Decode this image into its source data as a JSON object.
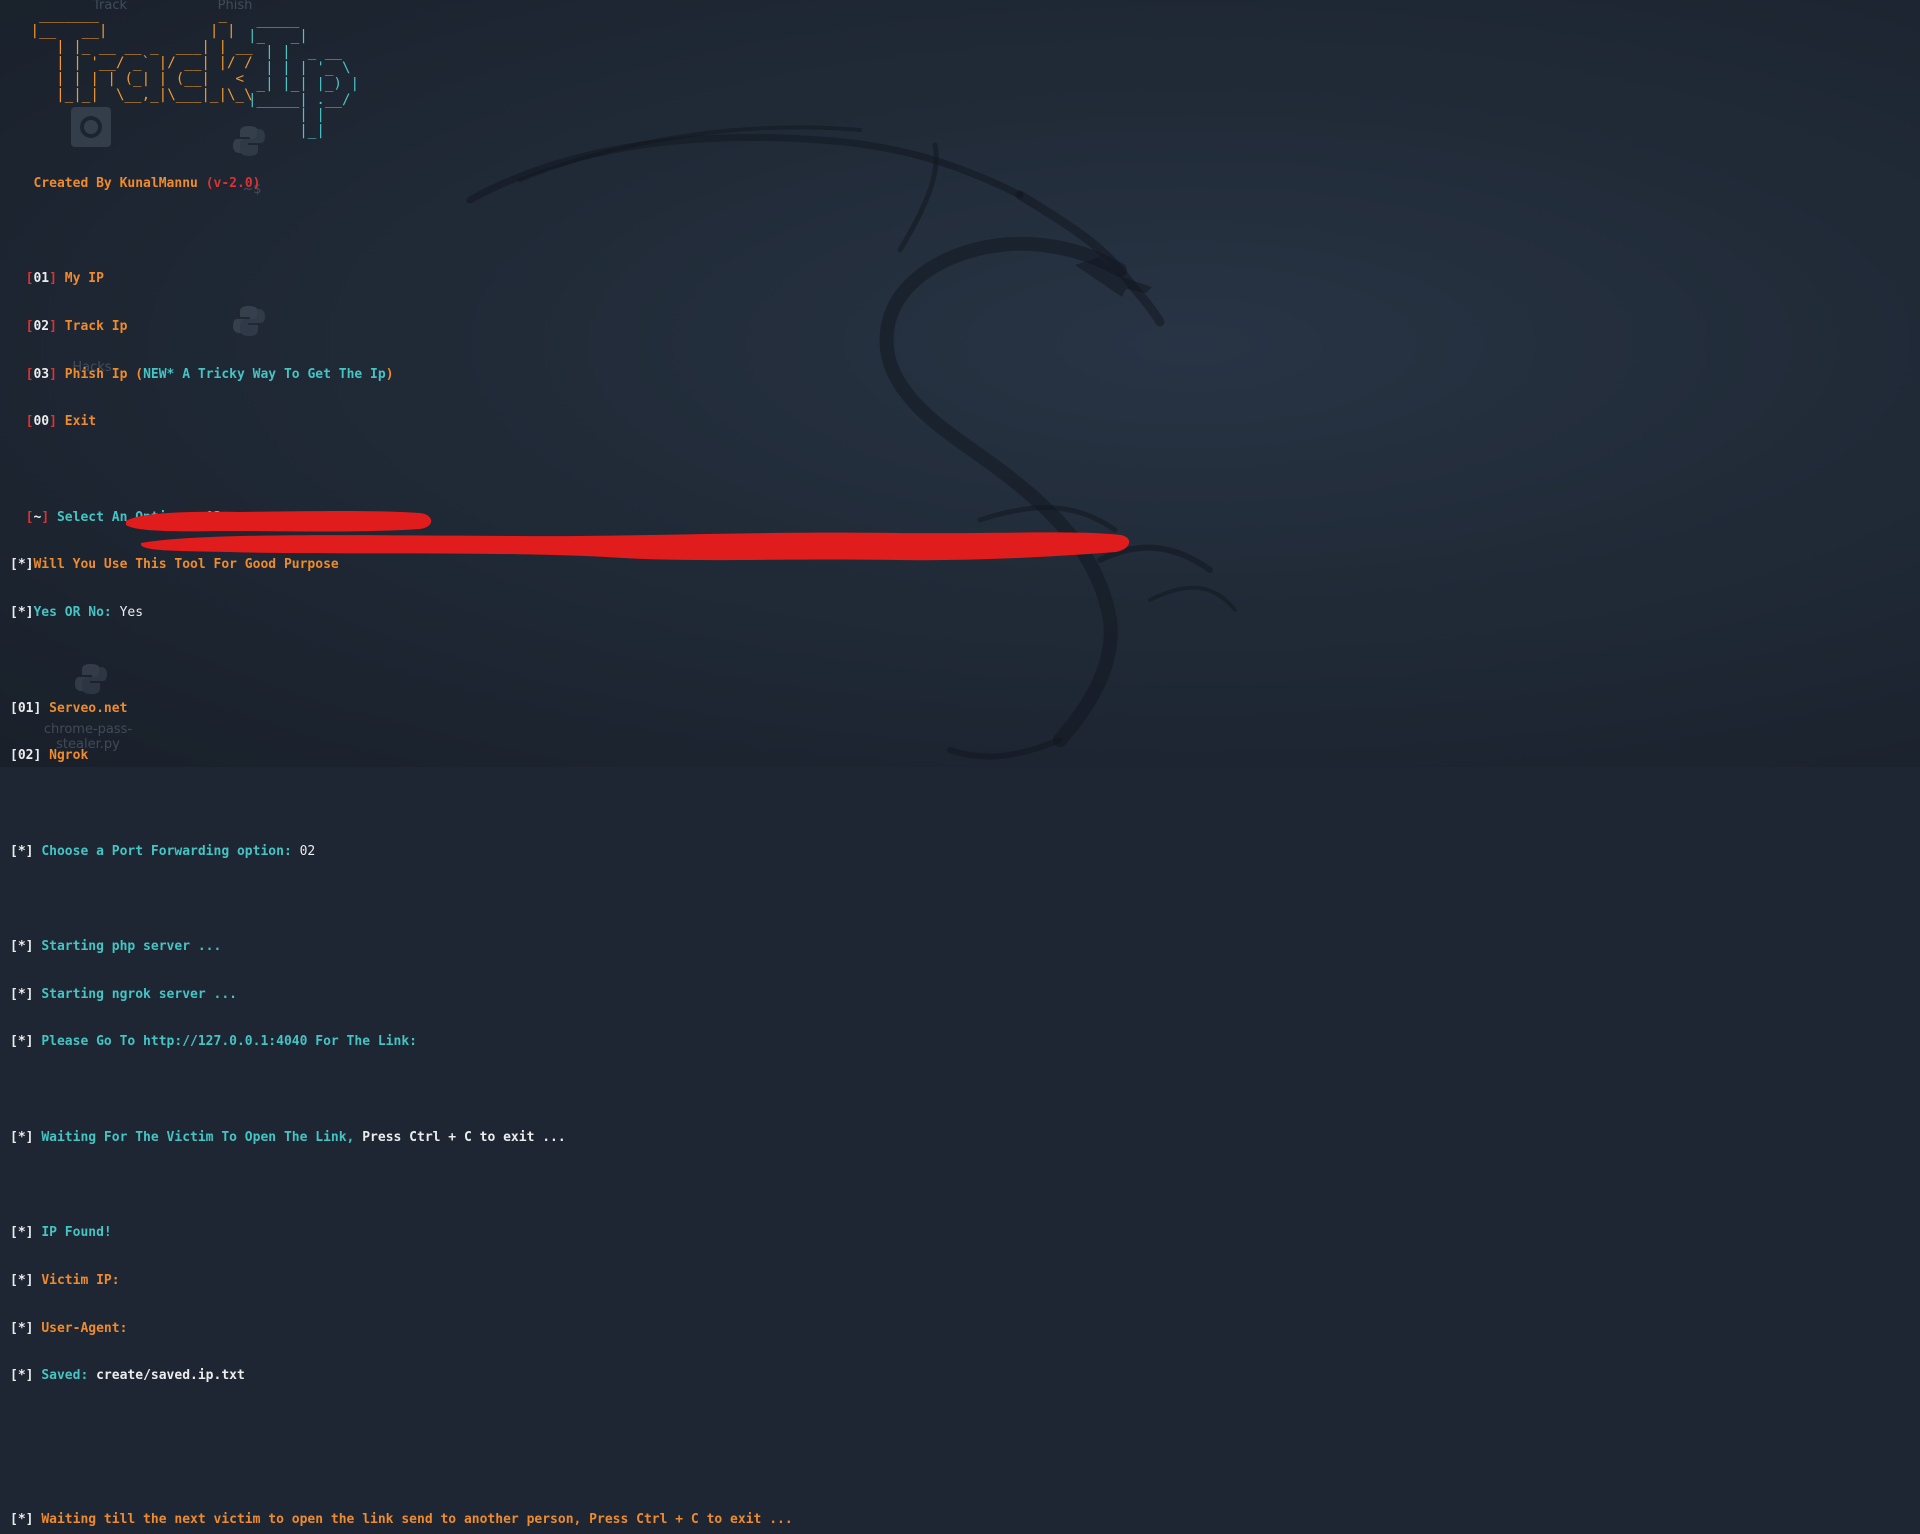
{
  "desktop": {
    "icons": [
      {
        "name": "top-file-1",
        "label": "Track"
      },
      {
        "name": "top-file-2",
        "label": "Phish"
      },
      {
        "name": "camera-file",
        "label": ""
      },
      {
        "name": "python-file-1",
        "label": "~$"
      },
      {
        "name": "python-file-2",
        "label": "Hacks"
      },
      {
        "name": "python-file-3",
        "label": ""
      },
      {
        "name": "python-file-bottom",
        "label": "chrome-pass-stealer.py"
      }
    ]
  },
  "banner": {
    "ascii_track": "  _______              _\n |__   __|            | |\n    | |_ __ __ _  ___| | __\n    | | '__/ _` |/ __| |/ /\n    | | | | (_| | (__|   <\n    |_|_|  \\__,_|\\___|_|\\_\\",
    "ascii_ip": " _____\n|_   _|\n  | |  _ __\n  | | | '_ \\\n _| |_| |_) |\n|_____| .__/\n      | |\n      |_|",
    "credit_text": "Created By KunalMannu",
    "version": "(v-2.0)"
  },
  "menu": [
    {
      "num": "01",
      "label": "My IP"
    },
    {
      "num": "02",
      "label": "Track Ip"
    },
    {
      "num": "03",
      "label": "Phish Ip",
      "note": "NEW* A Tricky Way To Get The Ip"
    },
    {
      "num": "00",
      "label": "Exit"
    }
  ],
  "prompts": {
    "select_mark": "~",
    "select_label": "Select An Option :",
    "select_value": "03",
    "purpose_question": "Will You Use This Tool For Good Purpose",
    "yes_no_label": "Yes OR No:",
    "yes_no_value": "Yes"
  },
  "forwarding": [
    {
      "num": "01",
      "label": "Serveo.net"
    },
    {
      "num": "02",
      "label": "Ngrok"
    }
  ],
  "choose": {
    "label": "Choose a Port Forwarding option:",
    "value": "02"
  },
  "status": {
    "star": "*",
    "php": "Starting php server ...",
    "ngrok": "Starting ngrok server ...",
    "link": "Please Go To http://127.0.0.1:4040 For The Link:",
    "waiting_a": "Waiting For The Victim To Open The Link,",
    "waiting_b": "Press Ctrl + C to exit ...",
    "found": "IP Found!",
    "victim_ip_label": "Victim IP:",
    "user_agent_label": "User-Agent:",
    "saved_label": "Saved:",
    "saved_path": "create/saved.ip.txt",
    "next_victim": "Waiting till the next victim to open the link send to another person, Press Ctrl + C to exit ..."
  },
  "colors": {
    "redaction": "#e01c1c",
    "background": "#1d2632",
    "orange": "#ef8b2c",
    "cyan": "#45c4c4"
  }
}
